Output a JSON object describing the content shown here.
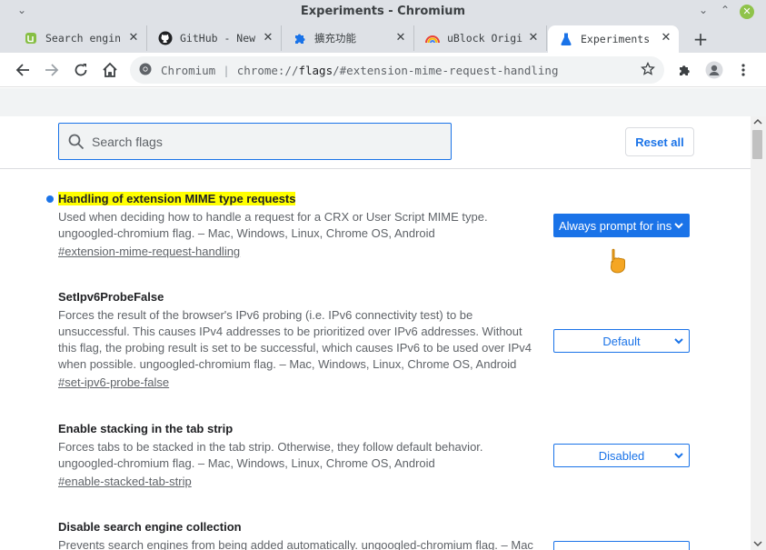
{
  "window": {
    "title": "Experiments - Chromium",
    "minimize": "⌄",
    "maximize": "⌃",
    "close": "✕",
    "menu": "⌄"
  },
  "tabs": [
    {
      "label": "Search engin",
      "icon": "mint-icon"
    },
    {
      "label": "GitHub - New",
      "icon": "github-icon"
    },
    {
      "label": "擴充功能",
      "icon": "puzzle-icon"
    },
    {
      "label": "uBlock Origi",
      "icon": "rainbow-icon"
    },
    {
      "label": "Experiments",
      "icon": "flask-icon"
    }
  ],
  "toolbar": {
    "origin": "Chromium",
    "url_prefix": "chrome://",
    "url_host": "flags",
    "url_path": "/#extension-mime-request-handling"
  },
  "search": {
    "placeholder": "Search flags",
    "reset_label": "Reset all"
  },
  "flags": [
    {
      "name": "Handling of extension MIME type requests",
      "description": "Used when deciding how to handle a request for a CRX or User Script MIME type. ungoogled-chromium flag. – Mac, Windows, Linux, Chrome OS, Android",
      "link": "#extension-mime-request-handling",
      "value": "Always prompt for ins"
    },
    {
      "name": "SetIpv6ProbeFalse",
      "description": "Forces the result of the browser's IPv6 probing (i.e. IPv6 connectivity test) to be unsuccessful. This causes IPv4 addresses to be prioritized over IPv6 addresses. Without this flag, the probing result is set to be successful, which causes IPv6 to be used over IPv4 when possible. ungoogled-chromium flag. – Mac, Windows, Linux, Chrome OS, Android",
      "link": "#set-ipv6-probe-false",
      "value": "Default"
    },
    {
      "name": "Enable stacking in the tab strip",
      "description": "Forces tabs to be stacked in the tab strip. Otherwise, they follow default behavior. ungoogled-chromium flag. – Mac, Windows, Linux, Chrome OS, Android",
      "link": "#enable-stacked-tab-strip",
      "value": "Disabled"
    },
    {
      "name": "Disable search engine collection",
      "description": "Prevents search engines from being added automatically. ungoogled-chromium flag. – Mac",
      "link": "",
      "value": ""
    }
  ],
  "colors": {
    "accent": "#1a73e8",
    "highlight": "#ffff00",
    "titlebar": "#dee1e6"
  }
}
